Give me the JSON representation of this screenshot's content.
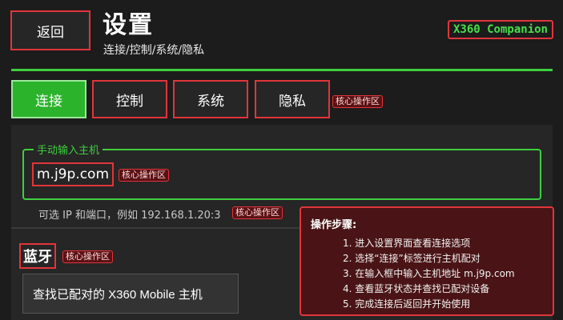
{
  "header": {
    "back_label": "返回",
    "title": "设置",
    "subtitle": "连接/控制/系统/隐私",
    "brand": "X360 Companion"
  },
  "tabs": [
    {
      "label": "连接",
      "active": true
    },
    {
      "label": "控制",
      "active": false
    },
    {
      "label": "系统",
      "active": false
    },
    {
      "label": "隐私",
      "active": false
    }
  ],
  "tags": {
    "core_zone": "核心操作区"
  },
  "manual": {
    "legend": "手动输入主机",
    "host_value": "m.j9p.com",
    "hint": "可选 IP 和端口，例如 192.168.1.20:3"
  },
  "bluetooth": {
    "title": "蓝牙",
    "find_button": "查找已配对的 X360 Mobile 主机"
  },
  "steps": {
    "title": "操作步骤:",
    "items": [
      "1. 进入设置界面查看连接选项",
      "2. 选择“连接”标签进行主机配对",
      "3. 在输入框中输入主机地址 m.j9p.com",
      "4. 查看蓝牙状态并查找已配对设备",
      "5. 完成连接后返回并开始使用"
    ]
  },
  "colors": {
    "accent_green": "#3ecf3e",
    "highlight_red": "#e0353a",
    "background": "#1c1c1c"
  }
}
